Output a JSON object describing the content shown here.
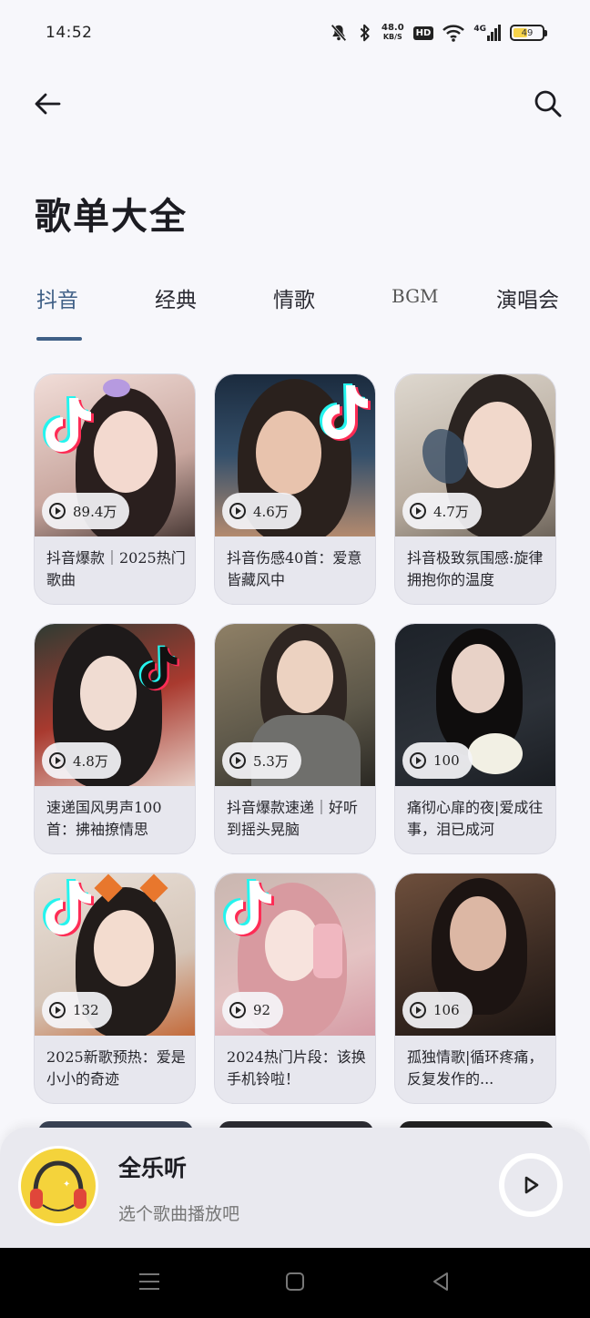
{
  "status_bar": {
    "time": "14:52",
    "net_speed_value": "48.0",
    "net_speed_unit": "KB/S",
    "hd": "HD",
    "signal": "4G",
    "battery": "49",
    "battery_level": 0.49,
    "battery_color": "#f7d44a"
  },
  "header": {
    "back_icon": "arrow-left-icon",
    "search_icon": "search-icon"
  },
  "page_title": "歌单大全",
  "tabs": [
    {
      "label": "抖音",
      "active": true
    },
    {
      "label": "经典",
      "active": false
    },
    {
      "label": "情歌",
      "active": false
    },
    {
      "label": "BGM",
      "active": false
    },
    {
      "label": "演唱会",
      "active": false
    }
  ],
  "accent_color": "#3f5f86",
  "playlists": [
    {
      "plays": "89.4万",
      "title": "抖音爆款｜2025热门歌曲"
    },
    {
      "plays": "4.6万",
      "title": "抖音伤感40首：爱意皆藏风中"
    },
    {
      "plays": "4.7万",
      "title": "抖音极致氛围感:旋律拥抱你的温度"
    },
    {
      "plays": "4.8万",
      "title": "速递国风男声100首：拂袖撩情思"
    },
    {
      "plays": "5.3万",
      "title": "抖音爆款速递｜好听到摇头晃脑"
    },
    {
      "plays": "100",
      "title": "痛彻心扉的夜|爱成往事，泪已成河"
    },
    {
      "plays": "132",
      "title": "2025新歌预热：爱是小小的奇迹"
    },
    {
      "plays": "92",
      "title": "2024热门片段：该换手机铃啦！"
    },
    {
      "plays": "106",
      "title": "孤独情歌|循环疼痛，反复发作的..."
    }
  ],
  "mini_player": {
    "title": "全乐听",
    "subtitle": "选个歌曲播放吧"
  }
}
